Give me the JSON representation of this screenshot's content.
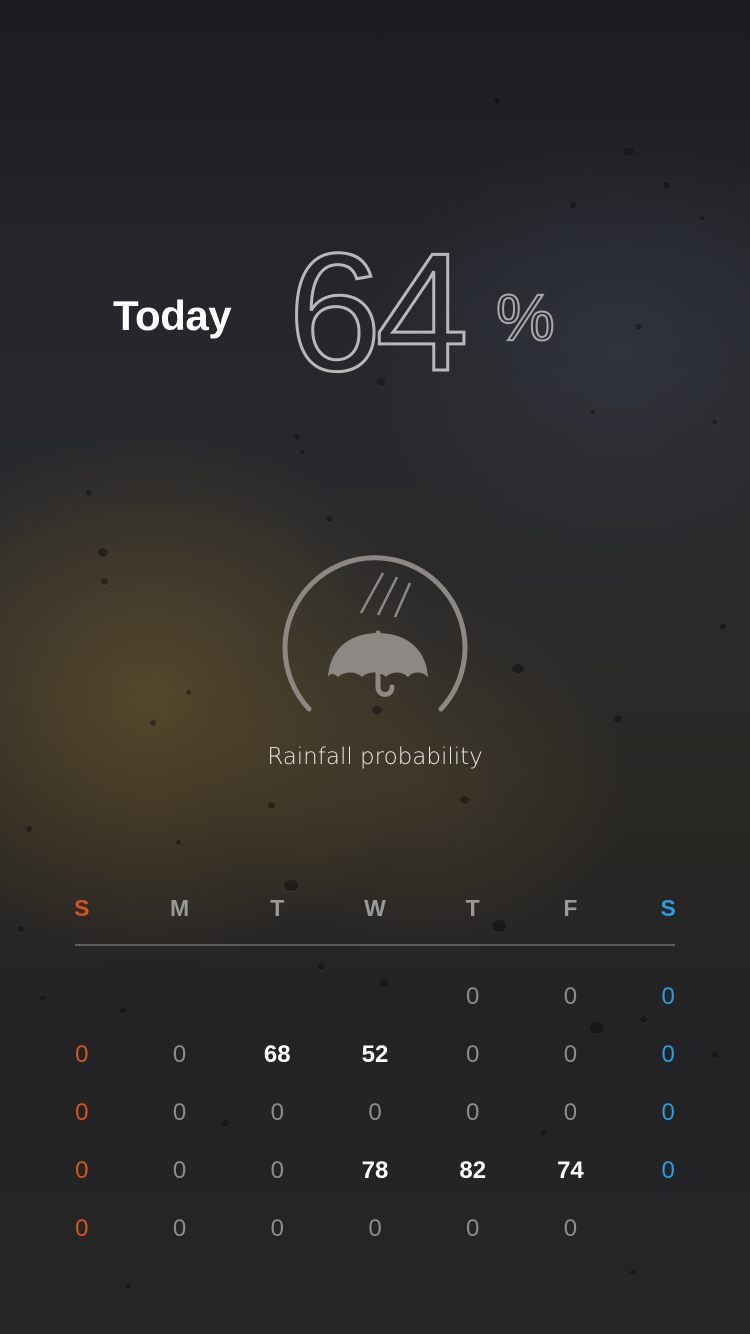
{
  "header": {
    "today_label": "Today",
    "percent_value": "64",
    "percent_sign": "%"
  },
  "gauge": {
    "icon": "umbrella-rain-icon",
    "caption": "Rainfall probability",
    "level_percent": 64
  },
  "calendar": {
    "day_headers": [
      "S",
      "M",
      "T",
      "W",
      "T",
      "F",
      "S"
    ],
    "rows": [
      [
        "",
        "",
        "",
        "",
        "0",
        "0",
        "0"
      ],
      [
        "0",
        "0",
        "68",
        "52",
        "0",
        "0",
        "0"
      ],
      [
        "0",
        "0",
        "0",
        "0",
        "0",
        "0",
        "0"
      ],
      [
        "0",
        "0",
        "0",
        "78",
        "82",
        "74",
        "0"
      ],
      [
        "0",
        "0",
        "0",
        "0",
        "0",
        "0",
        ""
      ]
    ]
  },
  "colors": {
    "sunday": "#d4551d",
    "saturday": "#2a9de0",
    "highlight": "#ffffff",
    "muted": "#8c8c8c"
  }
}
